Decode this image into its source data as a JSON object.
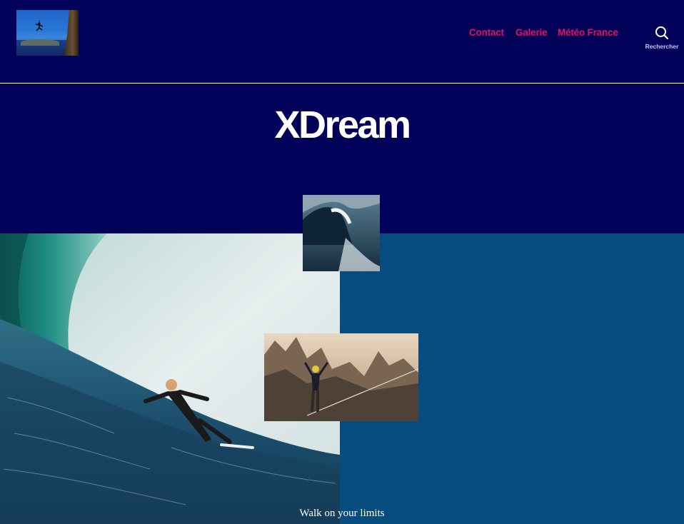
{
  "header": {
    "logo_icon": "climber-logo",
    "nav": [
      {
        "label": "Contact"
      },
      {
        "label": "Galerie"
      },
      {
        "label": "Météo France"
      }
    ],
    "search_label": "Rechercher",
    "search_icon": "search-icon"
  },
  "hero": {
    "title": "XDream",
    "tagline": "Walk on your limits"
  },
  "colors": {
    "background": "#02015a",
    "nav_link": "#e0115f",
    "right_panel": "#064c7f",
    "title": "#ffffff"
  }
}
